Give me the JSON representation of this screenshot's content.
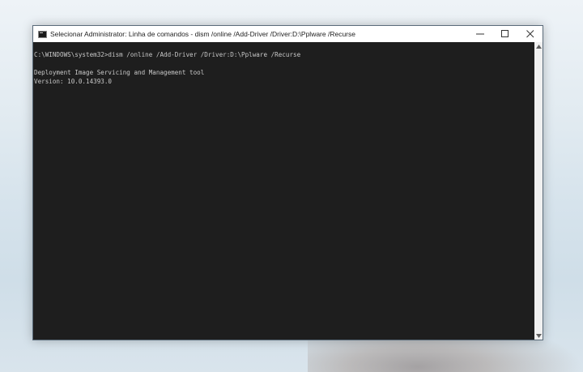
{
  "window": {
    "title": "Selecionar Administrator: Linha de comandos - dism  /online /Add-Driver /Driver:D:\\Pplware /Recurse",
    "controls": {
      "minimize_icon": "minimize-icon",
      "maximize_icon": "maximize-icon",
      "close_icon": "close-icon"
    }
  },
  "console": {
    "lines": [
      "C:\\WINDOWS\\system32>dism /online /Add-Driver /Driver:D:\\Pplware /Recurse",
      "",
      "Deployment Image Servicing and Management tool",
      "Version: 10.0.14393.0"
    ],
    "background": "#1e1e1e",
    "foreground": "#c8c8c8"
  }
}
